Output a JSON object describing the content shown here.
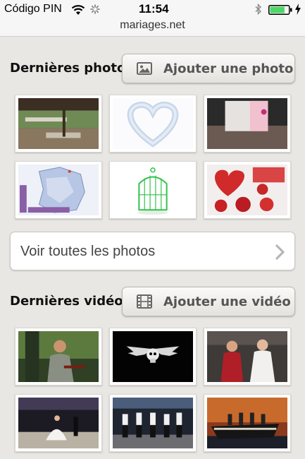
{
  "status_bar": {
    "carrier": "Código PIN",
    "time": "11:54",
    "battery_level": 0.8
  },
  "browser": {
    "url": "mariages.net"
  },
  "photos_section": {
    "title": "Dernières photos",
    "add_button_label": "Ajouter une photo",
    "add_icon": "image-icon",
    "thumbnails": [
      {
        "subject": "garden-reception"
      },
      {
        "subject": "feather-heart"
      },
      {
        "subject": "invitation-card"
      },
      {
        "subject": "france-map"
      },
      {
        "subject": "green-birdcage"
      },
      {
        "subject": "red-roses"
      }
    ],
    "see_all_label": "Voir toutes les photos"
  },
  "videos_section": {
    "title": "Dernières vidéos",
    "add_button_label": "Ajouter une vidéo",
    "add_icon": "film-icon",
    "thumbnails": [
      {
        "subject": "forest-actor"
      },
      {
        "subject": "winged-skull"
      },
      {
        "subject": "royal-wedding"
      },
      {
        "subject": "wedding-dance"
      },
      {
        "subject": "group-dance"
      },
      {
        "subject": "titanic-ship"
      }
    ]
  },
  "colors": {
    "page_background": "#e9e7e3",
    "button_text": "#555555",
    "battery_green": "#4cd964"
  }
}
